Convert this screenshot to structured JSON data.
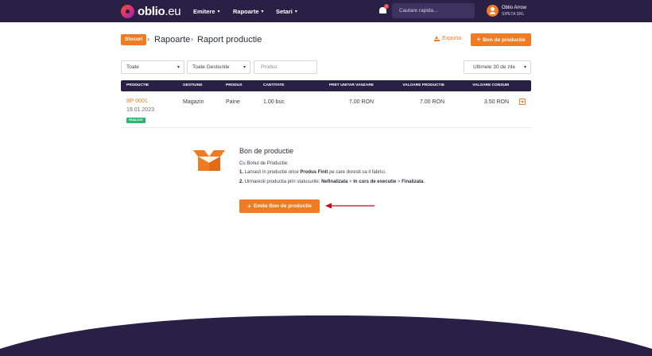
{
  "header": {
    "logo": {
      "brand": "oblio",
      "suffix": ".eu"
    },
    "nav": [
      {
        "label": "Emitere"
      },
      {
        "label": "Rapoarte"
      },
      {
        "label": "Setari"
      }
    ],
    "notifications_count": "1",
    "search_placeholder": "Cautare rapida...",
    "user": {
      "name": "Oblio Arrow",
      "company": "SIPETA SRL"
    }
  },
  "page": {
    "badge": "Stocuri",
    "breadcrumb_parent": "Rapoarte",
    "title": "Raport productie",
    "export_label": "Exporta",
    "new_button_label": "Bon de productie"
  },
  "filters": {
    "type": "Toate",
    "warehouses": "Toate Gestiunile",
    "product_placeholder": "Produs",
    "period": "Ultimele 30 de zile"
  },
  "table": {
    "columns": [
      "PRODUCTIE",
      "GESTIUNE",
      "PRODUS",
      "CANTITATE",
      "PRET UNITAR VANZARE",
      "VALOARE PRODUCTIE",
      "VALOARE CONSUM"
    ],
    "rows": [
      {
        "doc": "BP 0001",
        "date": "19.01.2023",
        "status": "FINALIZAT",
        "warehouse": "Magazin",
        "product": "Paine",
        "quantity": "1.00 buc",
        "unit_price": "7.00 RON",
        "production_value": "7.00 RON",
        "consumption_value": "3.50 RON"
      }
    ]
  },
  "info": {
    "title": "Bon de productie",
    "intro": "Cu Bonul de Productie:",
    "step1": {
      "num": "1.",
      "pre": "Lansezi in productie orice ",
      "bold": "Produs Finit",
      "post": " pe care doresti sa il fabrici."
    },
    "step2": {
      "num": "2.",
      "pre": "Urmaresti productia prin statusurile: ",
      "s1": "Nefinalizata",
      "sep1": " > ",
      "s2": "In curs de executie",
      "sep2": " > ",
      "s3": "Finalizata",
      "end": "."
    },
    "button_label": "Emite Bon de productie"
  },
  "colors": {
    "accent": "#f07b22",
    "nav_bg": "#2a1f45",
    "status_green": "#2bb673",
    "arrow_red": "#d0021b"
  }
}
